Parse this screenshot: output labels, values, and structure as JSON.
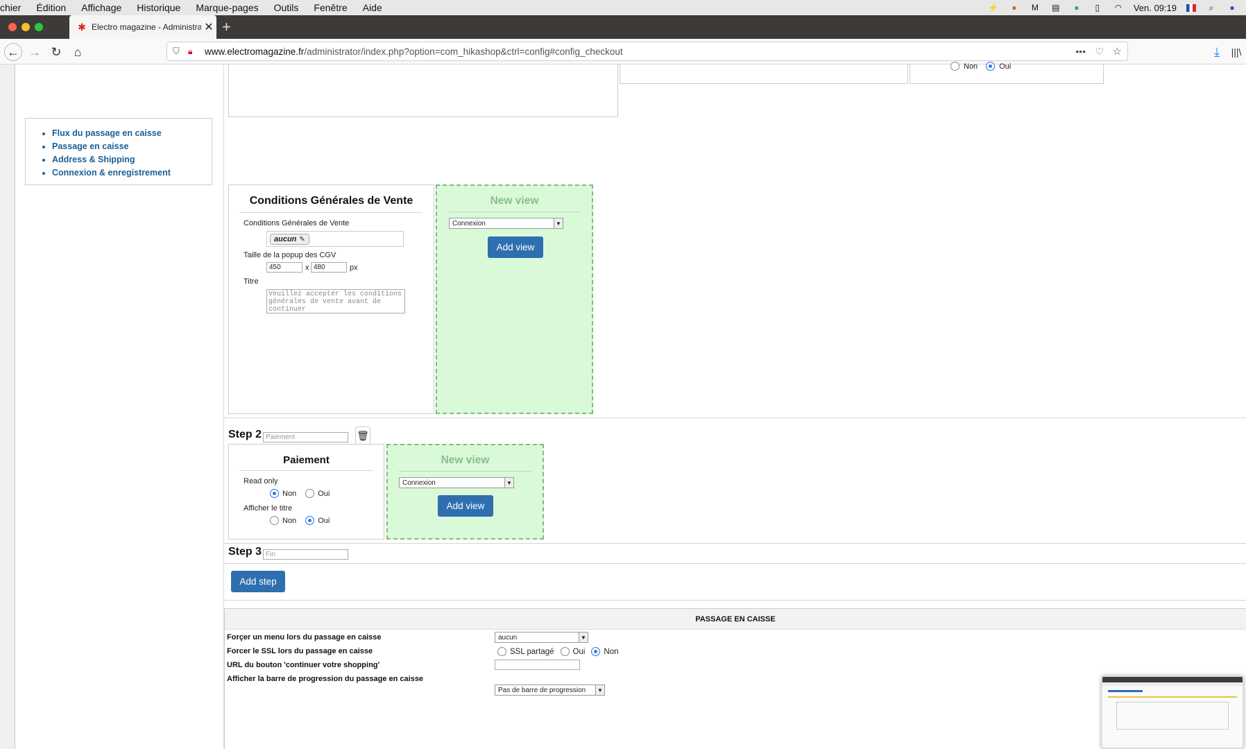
{
  "menubar": {
    "items": [
      "chier",
      "Édition",
      "Affichage",
      "Historique",
      "Marque-pages",
      "Outils",
      "Fenêtre",
      "Aide"
    ],
    "clock": "Ven. 09:19"
  },
  "tab": {
    "title": "Electro magazine - Administrati",
    "close": "✕"
  },
  "url": {
    "domain": "www.electromagazine.fr",
    "path": "/administrator/index.php?option=com_hikashop&ctrl=config#config_checkout"
  },
  "sidebar": {
    "links": [
      "Flux du passage en caisse",
      "Passage en caisse",
      "Address & Shipping",
      "Connexion & enregistrement"
    ]
  },
  "top_fragment": {
    "non": "Non",
    "oui": "Oui"
  },
  "cgv": {
    "title": "Conditions Générales de Vente",
    "field_label": "Conditions Générales de Vente",
    "tag": "aucun",
    "popup_label": "Taille de la popup des CGV",
    "width": "450",
    "x": "x",
    "height": "480",
    "unit": "px",
    "titre_label": "Titre",
    "titre_placeholder": "Veuillez accepter les conditions générales de vente avant de continuer"
  },
  "newview1": {
    "title": "New view",
    "select": "Connexion",
    "button": "Add view"
  },
  "step2": {
    "label": "Step 2",
    "placeholder": "Paiement"
  },
  "paiement": {
    "title": "Paiement",
    "read_only": "Read only",
    "afficher_titre": "Afficher le titre",
    "non": "Non",
    "oui": "Oui"
  },
  "newview2": {
    "title": "New view",
    "select": "Connexion",
    "button": "Add view"
  },
  "step3": {
    "label": "Step 3",
    "placeholder": "Fin"
  },
  "add_step": "Add step",
  "passage": {
    "header": "PASSAGE EN CAISSE",
    "rows": [
      {
        "label": "Forçer un menu lors du passage en caisse",
        "value": "aucun"
      },
      {
        "label": "Forcer le SSL lors du passage en caisse",
        "opt1": "SSL partagé",
        "opt2": "Oui",
        "opt3": "Non"
      },
      {
        "label": "URL du bouton 'continuer votre shopping'"
      },
      {
        "label": "Afficher la barre de progression du passage en caisse",
        "value": "Pas de barre de progression"
      }
    ]
  }
}
